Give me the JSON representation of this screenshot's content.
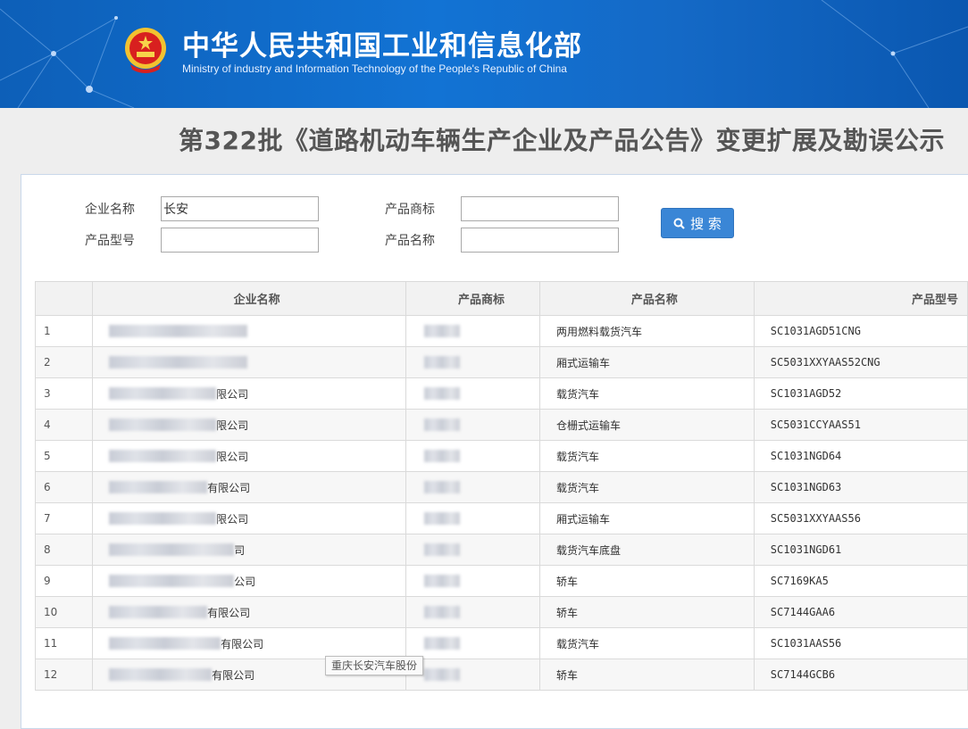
{
  "header": {
    "org_cn": "中华人民共和国工业和信息化部",
    "org_en": "Ministry of industry and Information Technology of the People's Republic of China"
  },
  "page_title": "第322批《道路机动车辆生产企业及产品公告》变更扩展及勘误公示",
  "search": {
    "company_label": "企业名称",
    "company_value": "长安",
    "brand_label": "产品商标",
    "brand_value": "",
    "model_label": "产品型号",
    "model_value": "",
    "product_label": "产品名称",
    "product_value": "",
    "button_label": "搜 索",
    "button_color": "#3a86d6"
  },
  "table": {
    "headers": [
      "",
      "企业名称",
      "产品商标",
      "产品名称",
      "产品型号"
    ],
    "rows": [
      {
        "no": "1",
        "company_tail": "",
        "product": "两用燃料载货汽车",
        "model": "SC1031AGD51CNG"
      },
      {
        "no": "2",
        "company_tail": "",
        "product": "厢式运输车",
        "model": "SC5031XXYAAS52CNG"
      },
      {
        "no": "3",
        "company_tail": "限公司",
        "product": "载货汽车",
        "model": "SC1031AGD52"
      },
      {
        "no": "4",
        "company_tail": "限公司",
        "product": "仓栅式运输车",
        "model": "SC5031CCYAAS51"
      },
      {
        "no": "5",
        "company_tail": "限公司",
        "product": "载货汽车",
        "model": "SC1031NGD64"
      },
      {
        "no": "6",
        "company_tail": "有限公司",
        "product": "载货汽车",
        "model": "SC1031NGD63"
      },
      {
        "no": "7",
        "company_tail": "限公司",
        "product": "厢式运输车",
        "model": "SC5031XXYAAS56"
      },
      {
        "no": "8",
        "company_tail": "司",
        "product": "载货汽车底盘",
        "model": "SC1031NGD61"
      },
      {
        "no": "9",
        "company_tail": "公司",
        "product": "轿车",
        "model": "SC7169KA5"
      },
      {
        "no": "10",
        "company_tail": "有限公司",
        "product": "轿车",
        "model": "SC7144GAA6"
      },
      {
        "no": "11",
        "company_tail": "有限公司",
        "product": "载货汽车",
        "model": "SC1031AAS56"
      },
      {
        "no": "12",
        "company_tail": "有限公司",
        "product": "轿车",
        "model": "SC7144GCB6"
      }
    ]
  },
  "tooltip": "重庆长安汽车股份"
}
